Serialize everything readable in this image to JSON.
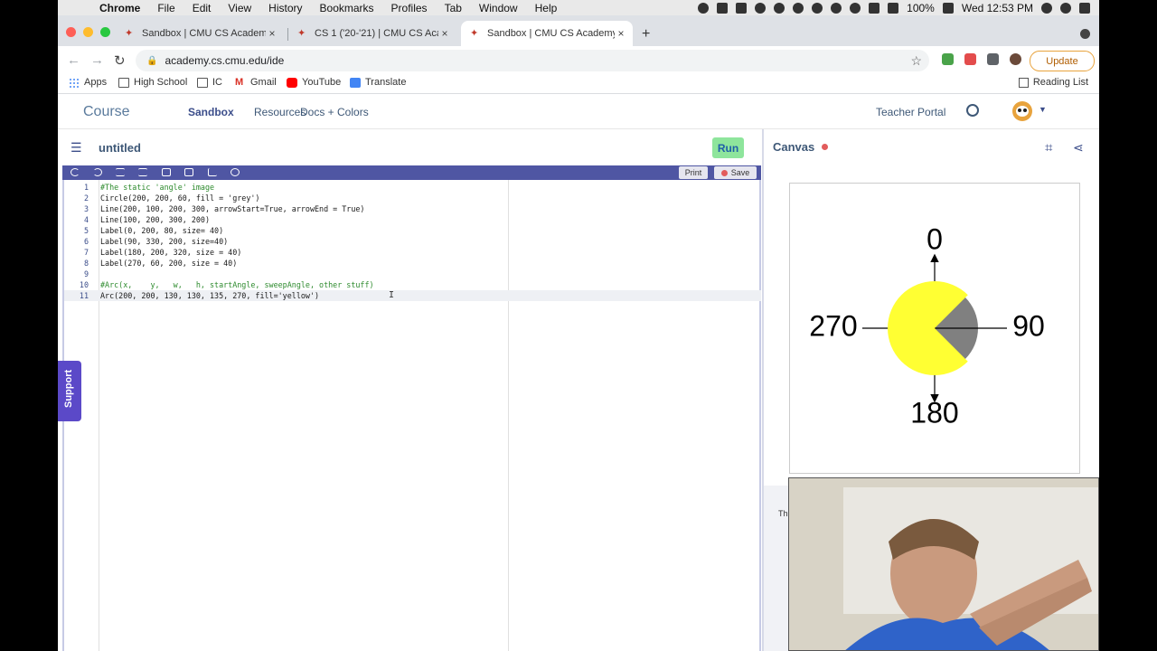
{
  "menubar": {
    "items": [
      "Chrome",
      "File",
      "Edit",
      "View",
      "History",
      "Bookmarks",
      "Profiles",
      "Tab",
      "Window",
      "Help"
    ],
    "battery": "100%",
    "clock": "Wed 12:53 PM"
  },
  "tabs": [
    {
      "title": "Sandbox | CMU CS Academy",
      "active": false
    },
    {
      "title": "CS 1 ('20-'21) | CMU CS Acade",
      "active": false
    },
    {
      "title": "Sandbox | CMU CS Academy",
      "active": true
    }
  ],
  "browser": {
    "url": "academy.cs.cmu.edu/ide",
    "update_label": "Update"
  },
  "bookmarks": [
    {
      "label": "Apps",
      "icon": "apps-grid-icon"
    },
    {
      "label": "High School",
      "icon": "folder-icon"
    },
    {
      "label": "IC",
      "icon": "folder-icon"
    },
    {
      "label": "Gmail",
      "icon": "gmail-icon"
    },
    {
      "label": "YouTube",
      "icon": "youtube-icon"
    },
    {
      "label": "Translate",
      "icon": "translate-icon"
    }
  ],
  "reading_list": "Reading List",
  "site_nav": {
    "course": "Course",
    "links": [
      "Sandbox",
      "Resources",
      "Docs + Colors"
    ],
    "teacher_portal": "Teacher Portal"
  },
  "editor": {
    "filename": "untitled",
    "run_label": "Run",
    "print_label": "Print",
    "save_label": "Save",
    "support_label": "Support",
    "lines": [
      {
        "n": "1",
        "text": "#The static 'angle' image",
        "comment": true
      },
      {
        "n": "2",
        "text": "Circle(200, 200, 60, fill = 'grey')",
        "comment": false
      },
      {
        "n": "3",
        "text": "Line(200, 100, 200, 300, arrowStart=True, arrowEnd = True)",
        "comment": false
      },
      {
        "n": "4",
        "text": "Line(100, 200, 300, 200)",
        "comment": false
      },
      {
        "n": "5",
        "text": "Label(0, 200, 80, size= 40)",
        "comment": false
      },
      {
        "n": "6",
        "text": "Label(90, 330, 200, size=40)",
        "comment": false
      },
      {
        "n": "7",
        "text": "Label(180, 200, 320, size = 40)",
        "comment": false
      },
      {
        "n": "8",
        "text": "Label(270, 60, 200, size = 40)",
        "comment": false
      },
      {
        "n": "9",
        "text": "",
        "comment": false
      },
      {
        "n": "10",
        "text": "#Arc(x,    y,   w,   h, startAngle, sweepAngle, other stuff)",
        "comment": true
      },
      {
        "n": "11",
        "text": "Arc(200, 200, 130, 130, 135, 270, fill='yellow')",
        "comment": false
      }
    ]
  },
  "canvas": {
    "title": "Canvas",
    "labels": {
      "top": "0",
      "right": "90",
      "bottom": "180",
      "left": "270"
    },
    "colors": {
      "circle": "#808080",
      "arc": "#ffff33"
    }
  },
  "bottom_panel_text": "Th"
}
